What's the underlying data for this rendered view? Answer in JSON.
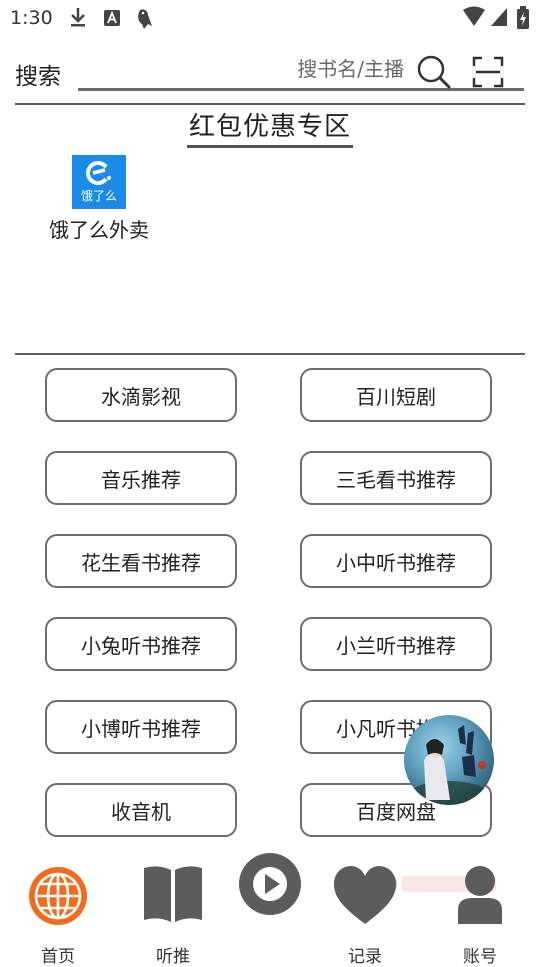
{
  "status_bar": {
    "time": "1:30"
  },
  "search": {
    "label": "搜索",
    "placeholder": "搜书名/主播"
  },
  "section": {
    "title": "红包优惠专区"
  },
  "promos": [
    {
      "name": "饿了么外卖",
      "logo_text": "饿了么"
    }
  ],
  "buttons": [
    "水滴影视",
    "百川短剧",
    "音乐推荐",
    "三毛看书推荐",
    "花生看书推荐",
    "小中听书推荐",
    "小兔听书推荐",
    "小兰听书推荐",
    "小博听书推荐",
    "小凡听书推荐",
    "收音机",
    "百度网盘"
  ],
  "tabs": [
    {
      "label": "首页",
      "icon": "globe-icon",
      "active": true
    },
    {
      "label": "听推",
      "icon": "book-icon"
    },
    {
      "label": "",
      "icon": "play-icon"
    },
    {
      "label": "记录",
      "icon": "heart-icon"
    },
    {
      "label": "账号",
      "icon": "person-icon"
    }
  ],
  "colors": {
    "accent": "#f26a1b",
    "brand_blue": "#1a8be8",
    "icon_gray": "#5c5c5c"
  }
}
